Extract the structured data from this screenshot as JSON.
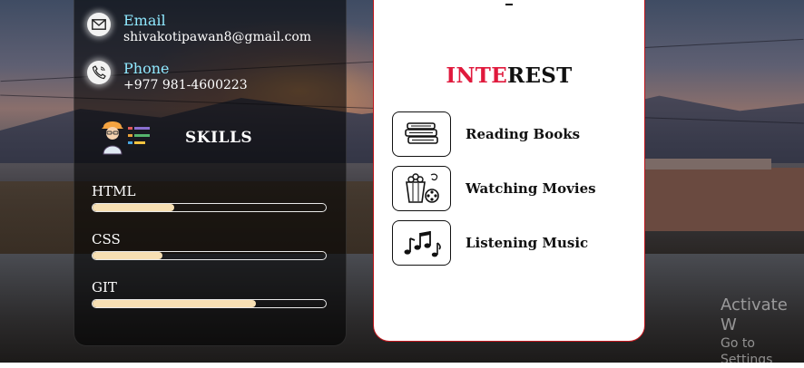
{
  "contact": {
    "email": {
      "title": "Email",
      "value": "shivakotipawan8@gmail.com",
      "icon": "envelope-icon"
    },
    "phone": {
      "title": "Phone",
      "value": "+977 981-4600223",
      "icon": "phone-icon"
    }
  },
  "skills": {
    "heading": "SKILLS",
    "icon": "developer-avatar-icon",
    "items": [
      {
        "name": "HTML",
        "level": 0.35
      },
      {
        "name": "CSS",
        "level": 0.3
      },
      {
        "name": "GIT",
        "level": 0.7
      }
    ]
  },
  "interest": {
    "heading_part1": "INTE",
    "heading_part2": "REST",
    "items": [
      {
        "label": "Reading Books",
        "icon": "books-icon"
      },
      {
        "label": "Watching Movies",
        "icon": "popcorn-film-icon"
      },
      {
        "label": "Listening Music",
        "icon": "music-notes-icon"
      }
    ]
  },
  "watermark": {
    "line1": "Activate W",
    "line2": "Go to Settings"
  },
  "colors": {
    "accent_red": "#e0193c",
    "contact_title": "#8fe8ff",
    "skill_fill": "#f7dfb3",
    "card_border": "#c0161c"
  }
}
